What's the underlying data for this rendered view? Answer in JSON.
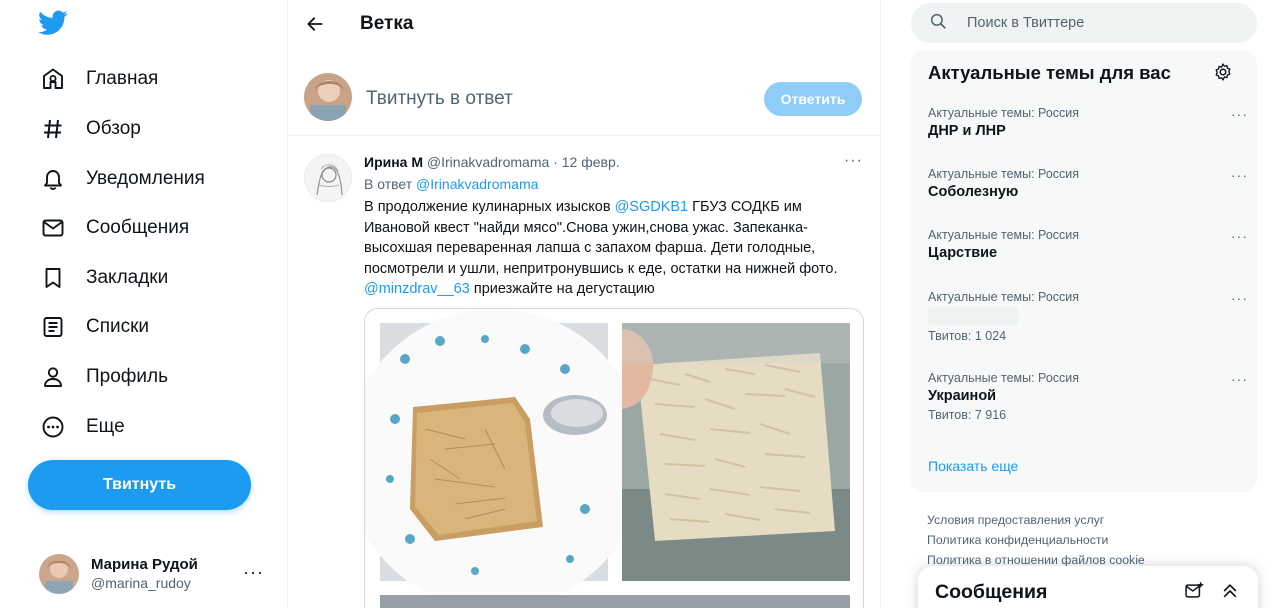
{
  "nav": {
    "items": [
      {
        "label": "Главная",
        "icon": "home-icon"
      },
      {
        "label": "Обзор",
        "icon": "hashtag-icon"
      },
      {
        "label": "Уведомления",
        "icon": "bell-icon"
      },
      {
        "label": "Сообщения",
        "icon": "mail-icon"
      },
      {
        "label": "Закладки",
        "icon": "bookmark-icon"
      },
      {
        "label": "Списки",
        "icon": "list-icon"
      },
      {
        "label": "Профиль",
        "icon": "person-icon"
      },
      {
        "label": "Еще",
        "icon": "more-circle-icon"
      }
    ],
    "tweet_button": "Твитнуть",
    "account": {
      "name": "Марина Рудой",
      "handle": "@marina_rudoy",
      "more": "···"
    }
  },
  "main": {
    "title": "Ветка",
    "reply": {
      "placeholder": "Твитнуть в ответ",
      "button": "Ответить"
    },
    "tweet": {
      "name": "Ирина М",
      "handle": "@Irinakvadromama",
      "sep": " · ",
      "date": "12 февр.",
      "more": "···",
      "reply_prefix": "В ответ ",
      "reply_to": "@Irinakvadromama",
      "text_1": "В продолжение кулинарных изысков ",
      "mention_1": "@SGDKB1",
      "text_2": " ГБУЗ СОДКБ им Ивановой квест \"найди мясо\".Снова ужин,снова ужас. Запеканка-высохшая переваренная лапша с запахом фарша. Дети голодные, посмотрели и ушли, непритронувшись к еде, остатки на нижней фото. ",
      "mention_2": "@minzdrav__63",
      "text_3": " приезжайте на дегустацию"
    }
  },
  "right": {
    "search_placeholder": "Поиск в Твиттере",
    "trends_title": "Актуальные темы для вас",
    "trends": [
      {
        "category": "Актуальные темы: Россия",
        "name": "ДНР и ЛНР",
        "count": ""
      },
      {
        "category": "Актуальные темы: Россия",
        "name": "Соболезную",
        "count": ""
      },
      {
        "category": "Актуальные темы: Россия",
        "name": "Царствие",
        "count": ""
      },
      {
        "category": "Актуальные темы: Россия",
        "name": "",
        "count": "Твитов: 1 024"
      },
      {
        "category": "Актуальные темы: Россия",
        "name": "Украиной",
        "count": "Твитов: 7 916"
      }
    ],
    "trend_more": "···",
    "show_more": "Показать еще",
    "footer": [
      "Условия предоставления услуг",
      "Политика конфиденциальности",
      "Политика в отношении файлов cookie"
    ],
    "messages_title": "Сообщения"
  },
  "colors": {
    "accent": "#1d9bf0",
    "accent_disabled": "#8ecdf8",
    "text_secondary": "#536471"
  }
}
